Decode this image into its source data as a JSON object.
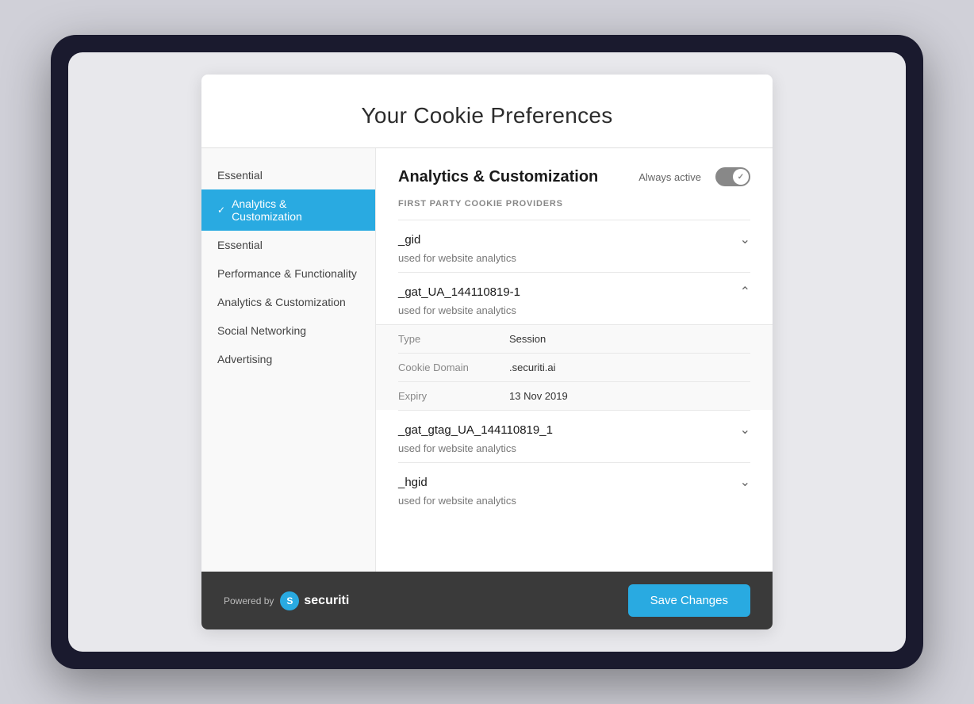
{
  "modal": {
    "title": "Your Cookie Preferences",
    "sidebar": {
      "items": [
        {
          "id": "essential-top",
          "label": "Essential",
          "active": false
        },
        {
          "id": "analytics-customization",
          "label": "Analytics & Customization",
          "active": true
        },
        {
          "id": "essential",
          "label": "Essential",
          "active": false
        },
        {
          "id": "performance-functionality",
          "label": "Performance & Functionality",
          "active": false
        },
        {
          "id": "analytics-customization-2",
          "label": "Analytics & Customization",
          "active": false
        },
        {
          "id": "social-networking",
          "label": "Social Networking",
          "active": false
        },
        {
          "id": "advertising",
          "label": "Advertising",
          "active": false
        }
      ]
    },
    "content": {
      "title": "Analytics & Customization",
      "always_active_label": "Always active",
      "section_label": "FIRST PARTY COOKIE PROVIDERS",
      "cookies": [
        {
          "name": "_gid",
          "description": "used for website analytics",
          "expanded": false
        },
        {
          "name": "_gat_UA_144110819-1",
          "description": "used for website analytics",
          "expanded": true,
          "details": [
            {
              "label": "Type",
              "value": "Session"
            },
            {
              "label": "Cookie Domain",
              "value": ".securiti.ai"
            },
            {
              "label": "Expiry",
              "value": "13 Nov 2019"
            }
          ]
        },
        {
          "name": "_gat_gtag_UA_144110819_1",
          "description": "used for website analytics",
          "expanded": false
        },
        {
          "name": "_hgid",
          "description": "used for website analytics",
          "expanded": false
        }
      ]
    },
    "footer": {
      "powered_by_label": "Powered by",
      "brand_name": "securiti",
      "save_button_label": "Save Changes"
    }
  }
}
